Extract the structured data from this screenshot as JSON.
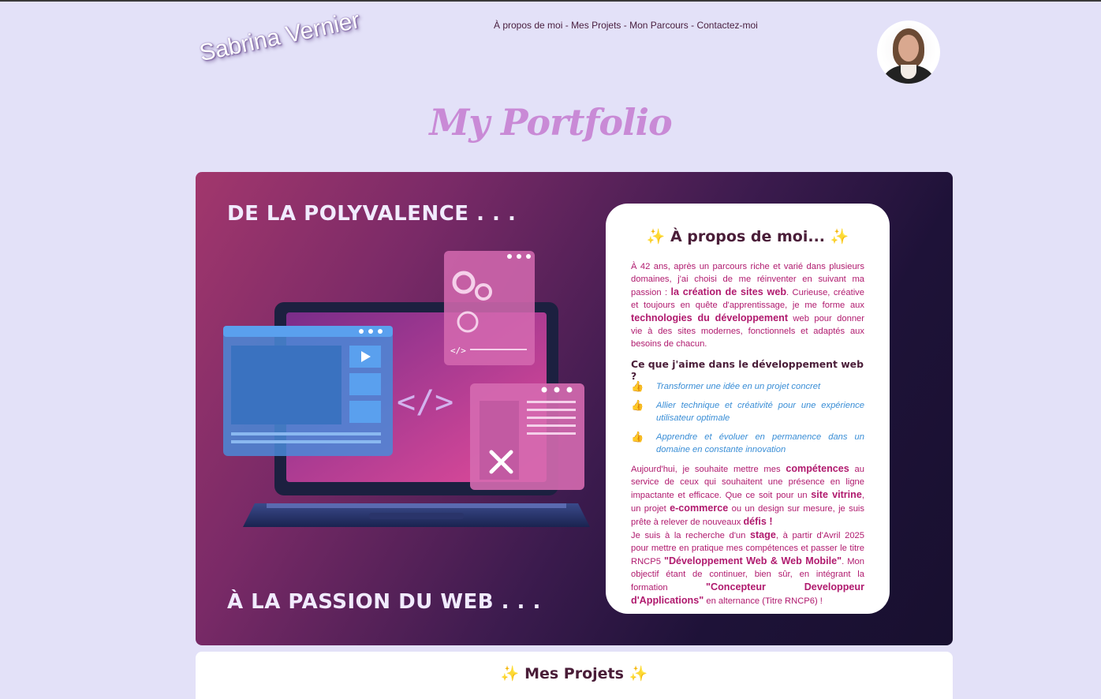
{
  "header": {
    "brand": "Sabrina Vernier",
    "nav": [
      "À propos de moi",
      "Mes Projets",
      "Mon Parcours",
      "Contactez-moi"
    ],
    "nav_separator": " - "
  },
  "main": {
    "title": "My Portfolio",
    "hero": {
      "line_top": "DE LA POLYVALENCE . . .",
      "line_bottom": "À LA PASSION DU WEB . . ."
    },
    "about": {
      "title": "À propos de moi...",
      "sparkle": "✨",
      "intro": [
        {
          "t": "À 42 ans, après un parcours riche et varié dans plusieurs domaines, j'ai choisi de me réinventer en suivant ma passion : ",
          "b": false
        },
        {
          "t": "la création de sites web",
          "b": true
        },
        {
          "t": ". Curieuse, créative et toujours en quête d'apprentissage, je me forme aux ",
          "b": false
        },
        {
          "t": "technologies du développement",
          "b": true
        },
        {
          "t": " web pour donner vie à des sites modernes, fonctionnels et adaptés aux besoins de chacun.",
          "b": false
        }
      ],
      "subtitle": "Ce que j'aime dans le développement web ?",
      "thumb": "👍",
      "likes": [
        "Transformer une idée en un projet concret",
        "Allier technique et créativité pour une expérience utilisateur optimale",
        "Apprendre et évoluer en permanence dans un domaine en constante innovation"
      ],
      "outro": [
        {
          "t": "Aujourd'hui, je souhaite mettre mes ",
          "b": false
        },
        {
          "t": "compétences",
          "b": true
        },
        {
          "t": " au service de ceux qui souhaitent une présence en ligne impactante et efficace. Que ce soit pour un ",
          "b": false
        },
        {
          "t": "site vitrine",
          "b": true
        },
        {
          "t": ", un projet ",
          "b": false
        },
        {
          "t": "e-commerce",
          "b": true
        },
        {
          "t": " ou un design sur mesure, je suis prête à relever de nouveaux ",
          "b": false
        },
        {
          "t": "défis !",
          "b": true
        },
        {
          "t": "\nJe suis à la recherche d'un ",
          "b": false
        },
        {
          "t": "stage",
          "b": true
        },
        {
          "t": ", à partir d'Avril 2025 pour mettre en pratique mes compétences et passer le titre RNCP5 ",
          "b": false
        },
        {
          "t": "\"Développement Web & Web Mobile\"",
          "b": true
        },
        {
          "t": ". Mon objectif étant de continuer, bien sûr, en intégrant la formation ",
          "b": false
        },
        {
          "t": "\"Concepteur Developpeur d'Applications\"",
          "b": true
        },
        {
          "t": " en alternance (Titre RNCP6) !",
          "b": false
        }
      ]
    },
    "projects": {
      "title": "Mes Projets"
    }
  },
  "colors": {
    "background": "#e3e1f8",
    "accent": "#b01a6e",
    "title_pink": "#c98ad6",
    "likes_blue": "#3a8ed6"
  }
}
